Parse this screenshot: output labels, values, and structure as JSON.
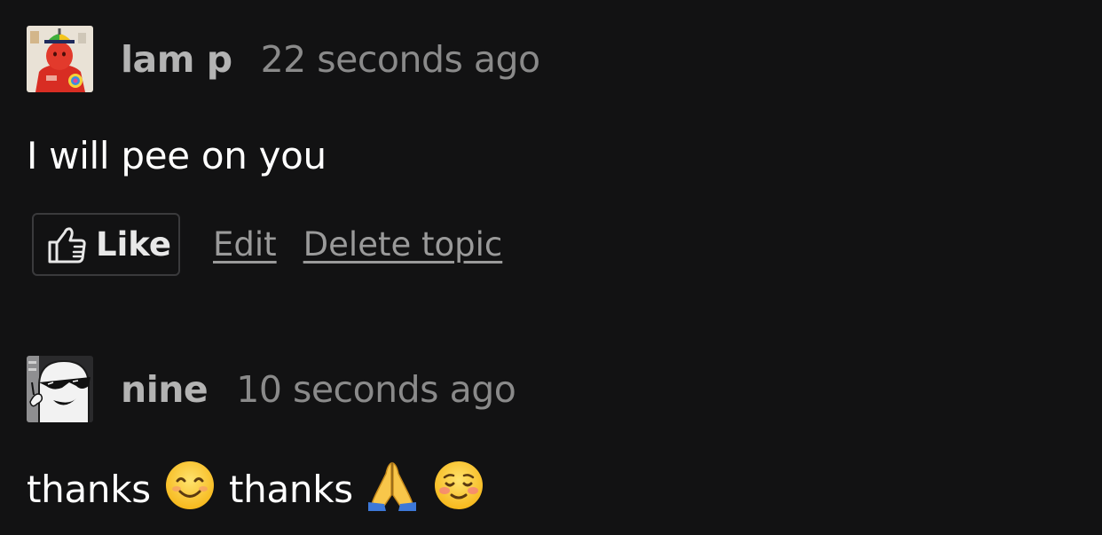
{
  "posts": [
    {
      "author": "lam p",
      "timestamp": "22 seconds ago",
      "body": "I will pee on you",
      "avatar_icon": "red-character-avatar",
      "actions": {
        "like_label": "Like",
        "edit_label": "Edit",
        "delete_label": "Delete topic"
      }
    },
    {
      "author": "nine",
      "timestamp": "10 seconds ago",
      "avatar_icon": "ghost-sunglasses-avatar",
      "body_parts": {
        "word1": "thanks",
        "emoji1": "smiling-face-emoji",
        "word2": "thanks",
        "emoji2": "folded-hands-emoji",
        "emoji3": "relieved-smiling-face-emoji"
      }
    }
  ],
  "colors": {
    "background": "#121213",
    "author": "#b3b3b3",
    "timestamp": "#8a8a8a",
    "body_text": "#ffffff",
    "link": "#9a9a9a",
    "like_border": "#3a3a3c"
  }
}
